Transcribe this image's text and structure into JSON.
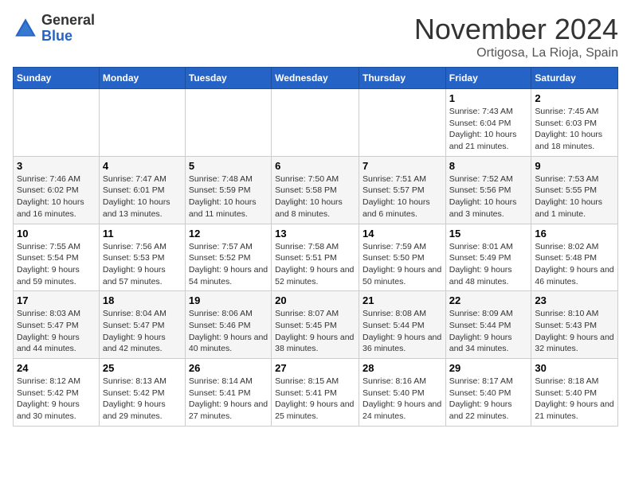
{
  "header": {
    "logo_line1": "General",
    "logo_line2": "Blue",
    "month": "November 2024",
    "location": "Ortigosa, La Rioja, Spain"
  },
  "weekdays": [
    "Sunday",
    "Monday",
    "Tuesday",
    "Wednesday",
    "Thursday",
    "Friday",
    "Saturday"
  ],
  "weeks": [
    [
      {
        "day": "",
        "info": ""
      },
      {
        "day": "",
        "info": ""
      },
      {
        "day": "",
        "info": ""
      },
      {
        "day": "",
        "info": ""
      },
      {
        "day": "",
        "info": ""
      },
      {
        "day": "1",
        "info": "Sunrise: 7:43 AM\nSunset: 6:04 PM\nDaylight: 10 hours and 21 minutes."
      },
      {
        "day": "2",
        "info": "Sunrise: 7:45 AM\nSunset: 6:03 PM\nDaylight: 10 hours and 18 minutes."
      }
    ],
    [
      {
        "day": "3",
        "info": "Sunrise: 7:46 AM\nSunset: 6:02 PM\nDaylight: 10 hours and 16 minutes."
      },
      {
        "day": "4",
        "info": "Sunrise: 7:47 AM\nSunset: 6:01 PM\nDaylight: 10 hours and 13 minutes."
      },
      {
        "day": "5",
        "info": "Sunrise: 7:48 AM\nSunset: 5:59 PM\nDaylight: 10 hours and 11 minutes."
      },
      {
        "day": "6",
        "info": "Sunrise: 7:50 AM\nSunset: 5:58 PM\nDaylight: 10 hours and 8 minutes."
      },
      {
        "day": "7",
        "info": "Sunrise: 7:51 AM\nSunset: 5:57 PM\nDaylight: 10 hours and 6 minutes."
      },
      {
        "day": "8",
        "info": "Sunrise: 7:52 AM\nSunset: 5:56 PM\nDaylight: 10 hours and 3 minutes."
      },
      {
        "day": "9",
        "info": "Sunrise: 7:53 AM\nSunset: 5:55 PM\nDaylight: 10 hours and 1 minute."
      }
    ],
    [
      {
        "day": "10",
        "info": "Sunrise: 7:55 AM\nSunset: 5:54 PM\nDaylight: 9 hours and 59 minutes."
      },
      {
        "day": "11",
        "info": "Sunrise: 7:56 AM\nSunset: 5:53 PM\nDaylight: 9 hours and 57 minutes."
      },
      {
        "day": "12",
        "info": "Sunrise: 7:57 AM\nSunset: 5:52 PM\nDaylight: 9 hours and 54 minutes."
      },
      {
        "day": "13",
        "info": "Sunrise: 7:58 AM\nSunset: 5:51 PM\nDaylight: 9 hours and 52 minutes."
      },
      {
        "day": "14",
        "info": "Sunrise: 7:59 AM\nSunset: 5:50 PM\nDaylight: 9 hours and 50 minutes."
      },
      {
        "day": "15",
        "info": "Sunrise: 8:01 AM\nSunset: 5:49 PM\nDaylight: 9 hours and 48 minutes."
      },
      {
        "day": "16",
        "info": "Sunrise: 8:02 AM\nSunset: 5:48 PM\nDaylight: 9 hours and 46 minutes."
      }
    ],
    [
      {
        "day": "17",
        "info": "Sunrise: 8:03 AM\nSunset: 5:47 PM\nDaylight: 9 hours and 44 minutes."
      },
      {
        "day": "18",
        "info": "Sunrise: 8:04 AM\nSunset: 5:47 PM\nDaylight: 9 hours and 42 minutes."
      },
      {
        "day": "19",
        "info": "Sunrise: 8:06 AM\nSunset: 5:46 PM\nDaylight: 9 hours and 40 minutes."
      },
      {
        "day": "20",
        "info": "Sunrise: 8:07 AM\nSunset: 5:45 PM\nDaylight: 9 hours and 38 minutes."
      },
      {
        "day": "21",
        "info": "Sunrise: 8:08 AM\nSunset: 5:44 PM\nDaylight: 9 hours and 36 minutes."
      },
      {
        "day": "22",
        "info": "Sunrise: 8:09 AM\nSunset: 5:44 PM\nDaylight: 9 hours and 34 minutes."
      },
      {
        "day": "23",
        "info": "Sunrise: 8:10 AM\nSunset: 5:43 PM\nDaylight: 9 hours and 32 minutes."
      }
    ],
    [
      {
        "day": "24",
        "info": "Sunrise: 8:12 AM\nSunset: 5:42 PM\nDaylight: 9 hours and 30 minutes."
      },
      {
        "day": "25",
        "info": "Sunrise: 8:13 AM\nSunset: 5:42 PM\nDaylight: 9 hours and 29 minutes."
      },
      {
        "day": "26",
        "info": "Sunrise: 8:14 AM\nSunset: 5:41 PM\nDaylight: 9 hours and 27 minutes."
      },
      {
        "day": "27",
        "info": "Sunrise: 8:15 AM\nSunset: 5:41 PM\nDaylight: 9 hours and 25 minutes."
      },
      {
        "day": "28",
        "info": "Sunrise: 8:16 AM\nSunset: 5:40 PM\nDaylight: 9 hours and 24 minutes."
      },
      {
        "day": "29",
        "info": "Sunrise: 8:17 AM\nSunset: 5:40 PM\nDaylight: 9 hours and 22 minutes."
      },
      {
        "day": "30",
        "info": "Sunrise: 8:18 AM\nSunset: 5:40 PM\nDaylight: 9 hours and 21 minutes."
      }
    ]
  ]
}
